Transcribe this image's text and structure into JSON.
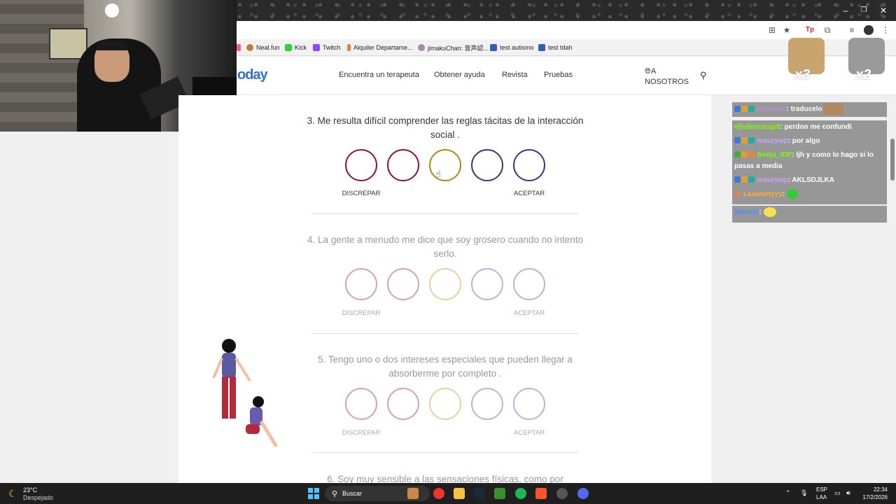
{
  "bookmarks": [
    "Neal.fun",
    "Kick",
    "Twitch",
    "Alquiler Departame...",
    "jimakuChan: 音声認...",
    "test autismo",
    "test tdah"
  ],
  "site": {
    "logo": "oday",
    "nav": [
      "Encuentra un terapeuta",
      "Obtener ayuda",
      "Revista",
      "Pruebas"
    ],
    "about_line1": "A",
    "about_line2": "NOSOTROS"
  },
  "questions": [
    {
      "text": "3. Me resulta difícil comprender las reglas tácitas de la interacción social .",
      "left_label": "DISCREPAR",
      "right_label": "ACEPTAR",
      "active": true
    },
    {
      "text": "4. La gente a menudo me dice que soy grosero cuando no intento serlo.",
      "left_label": "DISCREPAR",
      "right_label": "ACEPTAR",
      "active": false
    },
    {
      "text": "5. Tengo uno o dos intereses especiales que pueden llegar a absorberme por completo .",
      "left_label": "DISCREPAR",
      "right_label": "ACEPTAR",
      "active": false
    },
    {
      "text": "6. Soy muy sensible a las sensaciones físicas, como por",
      "active": false
    }
  ],
  "scale_colors": [
    "#8b1a2e",
    "#8b1a2e",
    "#b08a1e",
    "#3a3a7a",
    "#3a3a7a"
  ],
  "chat": [
    {
      "user": "ashtread",
      "user_color": "#b58ae0",
      "message": ": traducelo"
    },
    {
      "user": "eljulimascap8",
      "user_color": "#7cfc00",
      "message": ": perdon me confundi"
    },
    {
      "user": "maurywp",
      "user_color": "#c9a0ff",
      "message": ": por algo"
    },
    {
      "user": "Benja_IDP",
      "user_color": "#7cfc00",
      "message": ": ljh y como lo hago si lo pasas a media"
    },
    {
      "user": "maurywp",
      "user_color": "#c9a0ff",
      "message": ": AKLSDJLKA"
    },
    {
      "user": "Laawwttyyy",
      "user_color": "#ffaa33",
      "message": ":"
    },
    {
      "user": "Weoshi",
      "user_color": "#4c8dff",
      "message": ":"
    }
  ],
  "overlay": {
    "left_count": "x3",
    "right_count": "x2"
  },
  "taskbar": {
    "weather_temp": "23°C",
    "weather_text": "Despejado",
    "search": "Buscar",
    "lang1": "ESP",
    "lang2": "LAA",
    "time": "22:34",
    "date": "17/2/2026"
  }
}
